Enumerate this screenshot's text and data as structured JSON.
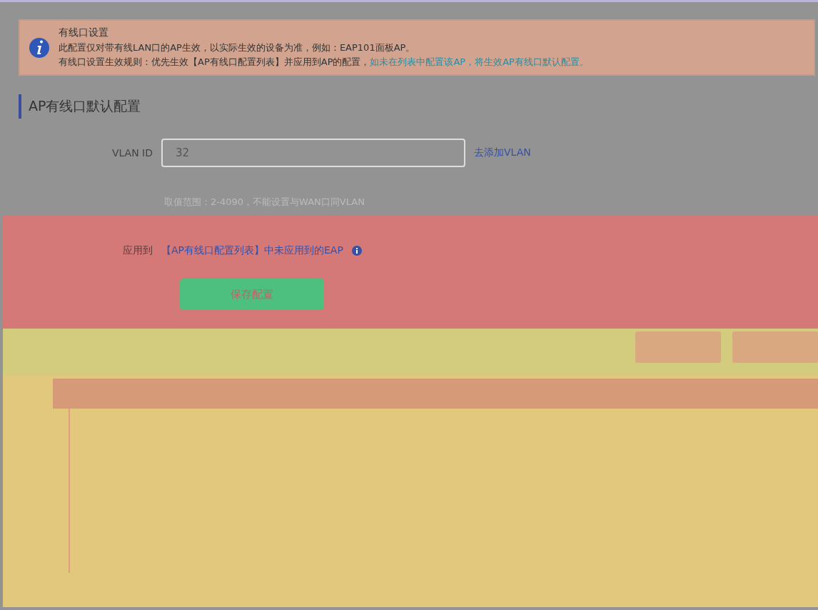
{
  "notice": {
    "title": "有线口设置",
    "lines": [
      "此配置仅对带有线LAN口的AP生效，以实际生效的设备为准，例如：EAP101面板AP。",
      "有线口设置生效规则：优先生效【AP有线口配置列表】并应用到AP的配置，"
    ],
    "link": "如未在列表中配置该AP，将生效AP有线口默认配置。"
  },
  "section": {
    "title": "AP有线口默认配置"
  },
  "form": {
    "vlan_label": "VLAN ID",
    "vlan_value": "32",
    "vlan_link": "去添加VLAN",
    "hint": "取值范围：2-4090，不能设置与WAN口同VLAN",
    "apply_label": "应用到",
    "apply_link": "【AP有线口配置列表】中未应用到的EAP",
    "save": "保存配置"
  }
}
